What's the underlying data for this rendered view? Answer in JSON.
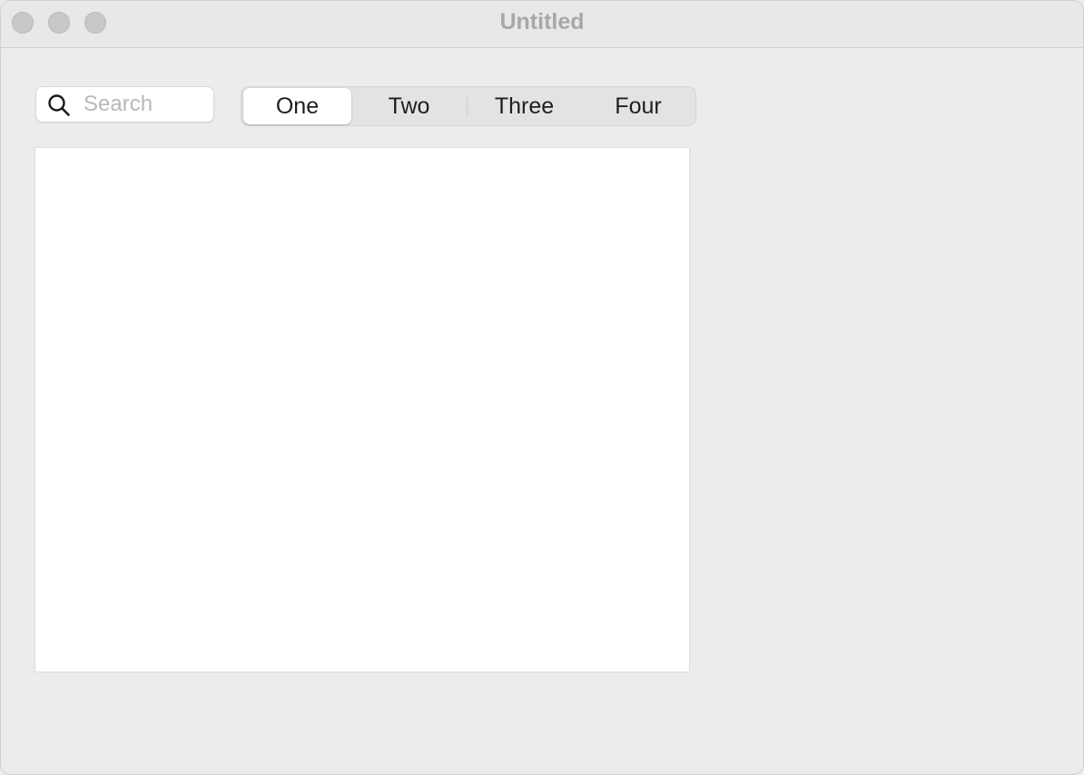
{
  "window": {
    "title": "Untitled"
  },
  "search": {
    "placeholder": "Search",
    "value": "",
    "icon": "magnifying-glass-icon"
  },
  "segmented_control": {
    "segments": [
      {
        "label": "One",
        "selected": true
      },
      {
        "label": "Two",
        "selected": false
      },
      {
        "label": "Three",
        "selected": false
      },
      {
        "label": "Four",
        "selected": false
      }
    ]
  },
  "colors": {
    "window_background": "#ececec",
    "title_text": "#a8a8a8",
    "content_background": "#ffffff",
    "traffic_light_inactive": "#c8c8c8"
  }
}
